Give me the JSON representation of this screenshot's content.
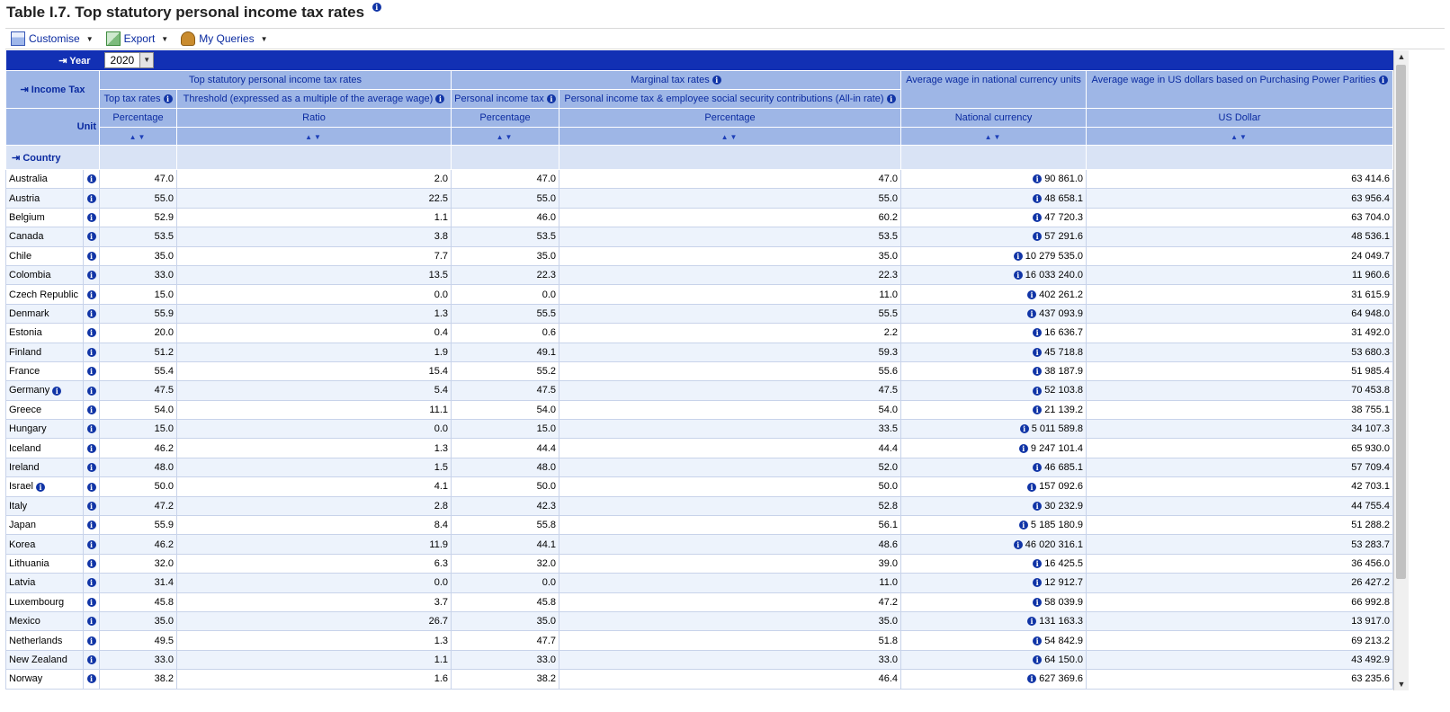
{
  "title": "Table I.7. Top statutory personal income tax rates",
  "toolbar": {
    "customise": "Customise",
    "export": "Export",
    "queries": "My Queries"
  },
  "dims": {
    "year": "Year",
    "year_value": "2020",
    "income_tax": "Income Tax",
    "unit": "Unit",
    "country": "Country"
  },
  "groups": {
    "top_statutory": "Top statutory personal income tax rates",
    "marginal": "Marginal tax rates",
    "avg_wage_national": "Average wage in national currency units",
    "avg_wage_usd": "Average wage in US dollars based on Purchasing Power Parities"
  },
  "subheaders": {
    "top_tax_rates": "Top tax rates",
    "threshold": "Threshold (expressed as a multiple of the average wage)",
    "pit": "Personal income tax",
    "pit_ssc": "Personal income tax & employee social security contributions (All-in rate)"
  },
  "units": {
    "c1": "Percentage",
    "c2": "Ratio",
    "c3": "Percentage",
    "c4": "Percentage",
    "c5": "National currency",
    "c6": "US Dollar"
  },
  "rows": [
    {
      "country": "Australia",
      "c1": "47.0",
      "c2": "2.0",
      "c3": "47.0",
      "c4": "47.0",
      "c5": "90 861.0",
      "c6": "63 414.6"
    },
    {
      "country": "Austria",
      "c1": "55.0",
      "c2": "22.5",
      "c3": "55.0",
      "c4": "55.0",
      "c5": "48 658.1",
      "c6": "63 956.4"
    },
    {
      "country": "Belgium",
      "c1": "52.9",
      "c2": "1.1",
      "c3": "46.0",
      "c4": "60.2",
      "c5": "47 720.3",
      "c6": "63 704.0"
    },
    {
      "country": "Canada",
      "c1": "53.5",
      "c2": "3.8",
      "c3": "53.5",
      "c4": "53.5",
      "c5": "57 291.6",
      "c6": "48 536.1"
    },
    {
      "country": "Chile",
      "c1": "35.0",
      "c2": "7.7",
      "c3": "35.0",
      "c4": "35.0",
      "c5": "10 279 535.0",
      "c6": "24 049.7"
    },
    {
      "country": "Colombia",
      "c1": "33.0",
      "c2": "13.5",
      "c3": "22.3",
      "c4": "22.3",
      "c5": "16 033 240.0",
      "c6": "11 960.6"
    },
    {
      "country": "Czech Republic",
      "c1": "15.0",
      "c2": "0.0",
      "c3": "0.0",
      "c4": "11.0",
      "c5": "402 261.2",
      "c6": "31 615.9"
    },
    {
      "country": "Denmark",
      "c1": "55.9",
      "c2": "1.3",
      "c3": "55.5",
      "c4": "55.5",
      "c5": "437 093.9",
      "c6": "64 948.0"
    },
    {
      "country": "Estonia",
      "c1": "20.0",
      "c2": "0.4",
      "c3": "0.6",
      "c4": "2.2",
      "c5": "16 636.7",
      "c6": "31 492.0"
    },
    {
      "country": "Finland",
      "c1": "51.2",
      "c2": "1.9",
      "c3": "49.1",
      "c4": "59.3",
      "c5": "45 718.8",
      "c6": "53 680.3"
    },
    {
      "country": "France",
      "c1": "55.4",
      "c2": "15.4",
      "c3": "55.2",
      "c4": "55.6",
      "c5": "38 187.9",
      "c6": "51 985.4"
    },
    {
      "country": "Germany",
      "c1": "47.5",
      "c2": "5.4",
      "c3": "47.5",
      "c4": "47.5",
      "c5": "52 103.8",
      "c6": "70 453.8",
      "note": true
    },
    {
      "country": "Greece",
      "c1": "54.0",
      "c2": "11.1",
      "c3": "54.0",
      "c4": "54.0",
      "c5": "21 139.2",
      "c6": "38 755.1"
    },
    {
      "country": "Hungary",
      "c1": "15.0",
      "c2": "0.0",
      "c3": "15.0",
      "c4": "33.5",
      "c5": "5 011 589.8",
      "c6": "34 107.3"
    },
    {
      "country": "Iceland",
      "c1": "46.2",
      "c2": "1.3",
      "c3": "44.4",
      "c4": "44.4",
      "c5": "9 247 101.4",
      "c6": "65 930.0"
    },
    {
      "country": "Ireland",
      "c1": "48.0",
      "c2": "1.5",
      "c3": "48.0",
      "c4": "52.0",
      "c5": "46 685.1",
      "c6": "57 709.4"
    },
    {
      "country": "Israel",
      "c1": "50.0",
      "c2": "4.1",
      "c3": "50.0",
      "c4": "50.0",
      "c5": "157 092.6",
      "c6": "42 703.1",
      "note": true
    },
    {
      "country": "Italy",
      "c1": "47.2",
      "c2": "2.8",
      "c3": "42.3",
      "c4": "52.8",
      "c5": "30 232.9",
      "c6": "44 755.4"
    },
    {
      "country": "Japan",
      "c1": "55.9",
      "c2": "8.4",
      "c3": "55.8",
      "c4": "56.1",
      "c5": "5 185 180.9",
      "c6": "51 288.2"
    },
    {
      "country": "Korea",
      "c1": "46.2",
      "c2": "11.9",
      "c3": "44.1",
      "c4": "48.6",
      "c5": "46 020 316.1",
      "c6": "53 283.7"
    },
    {
      "country": "Lithuania",
      "c1": "32.0",
      "c2": "6.3",
      "c3": "32.0",
      "c4": "39.0",
      "c5": "16 425.5",
      "c6": "36 456.0"
    },
    {
      "country": "Latvia",
      "c1": "31.4",
      "c2": "0.0",
      "c3": "0.0",
      "c4": "11.0",
      "c5": "12 912.7",
      "c6": "26 427.2"
    },
    {
      "country": "Luxembourg",
      "c1": "45.8",
      "c2": "3.7",
      "c3": "45.8",
      "c4": "47.2",
      "c5": "58 039.9",
      "c6": "66 992.8"
    },
    {
      "country": "Mexico",
      "c1": "35.0",
      "c2": "26.7",
      "c3": "35.0",
      "c4": "35.0",
      "c5": "131 163.3",
      "c6": "13 917.0"
    },
    {
      "country": "Netherlands",
      "c1": "49.5",
      "c2": "1.3",
      "c3": "47.7",
      "c4": "51.8",
      "c5": "54 842.9",
      "c6": "69 213.2"
    },
    {
      "country": "New Zealand",
      "c1": "33.0",
      "c2": "1.1",
      "c3": "33.0",
      "c4": "33.0",
      "c5": "64 150.0",
      "c6": "43 492.9"
    },
    {
      "country": "Norway",
      "c1": "38.2",
      "c2": "1.6",
      "c3": "38.2",
      "c4": "46.4",
      "c5": "627 369.6",
      "c6": "63 235.6"
    }
  ]
}
